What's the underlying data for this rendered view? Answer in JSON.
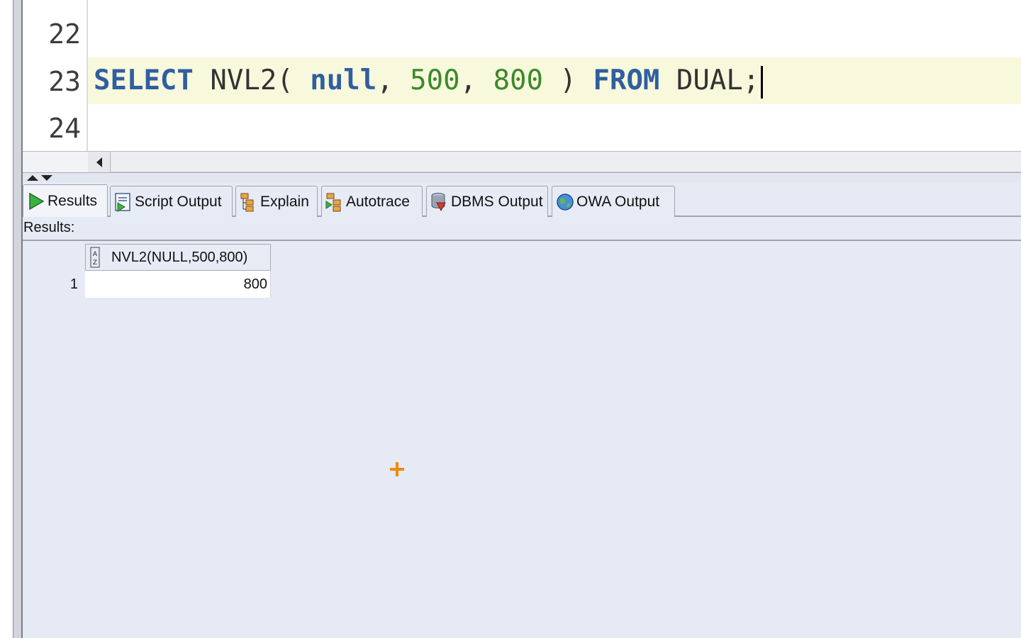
{
  "editor": {
    "lines": [
      {
        "number": "22",
        "code": ""
      },
      {
        "number": "23",
        "code": "SELECT NVL2( null, 500, 800 ) FROM DUAL;"
      },
      {
        "number": "24",
        "code": ""
      }
    ],
    "tokens": {
      "select": "SELECT",
      "func": "NVL2(",
      "null": "null",
      "comma1": ",",
      "num1": "500",
      "comma2": ",",
      "num2": "800",
      "close": ")",
      "from": "FROM",
      "table": "DUAL;"
    }
  },
  "tabs": [
    {
      "label": "Results",
      "icon": "run-triangle-icon",
      "active": true
    },
    {
      "label": "Script Output",
      "icon": "script-output-icon",
      "active": false
    },
    {
      "label": "Explain",
      "icon": "explain-plan-icon",
      "active": false
    },
    {
      "label": "Autotrace",
      "icon": "autotrace-icon",
      "active": false
    },
    {
      "label": "DBMS Output",
      "icon": "dbms-output-icon",
      "active": false
    },
    {
      "label": "OWA Output",
      "icon": "owa-globe-icon",
      "active": false
    }
  ],
  "results": {
    "label": "Results:",
    "columns": [
      "NVL2(NULL,500,800)"
    ],
    "rows": [
      {
        "row_number": "1",
        "values": [
          "800"
        ]
      }
    ]
  },
  "colors": {
    "keyword": "#2f5fa0",
    "number_literal": "#3b8a2a",
    "current_line": "#f8f8dc",
    "panel_background": "#e5eaf5",
    "cursor": "#f08a00"
  }
}
